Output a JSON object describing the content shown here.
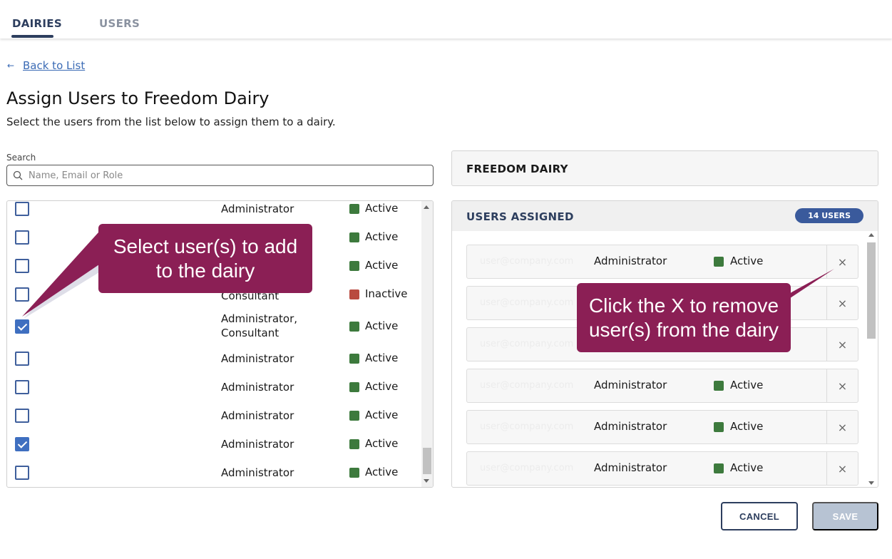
{
  "tabs": [
    {
      "label": "DAIRIES",
      "active": true
    },
    {
      "label": "USERS",
      "active": false
    }
  ],
  "back_link": {
    "arrow": "←",
    "label": "Back to List"
  },
  "page": {
    "title": "Assign Users to Freedom Dairy",
    "subtitle": "Select the users from the list below to assign them to a dairy."
  },
  "search": {
    "label": "Search",
    "placeholder": "Name, Email or Role",
    "value": ""
  },
  "available_users": [
    {
      "checked": false,
      "role": "Administrator",
      "role2": "",
      "status": "Active"
    },
    {
      "checked": false,
      "role": "",
      "role2": "",
      "status": "Active"
    },
    {
      "checked": false,
      "role": "",
      "role2": "",
      "status": "Active"
    },
    {
      "checked": false,
      "role": "Consultant",
      "role2": "",
      "status": "Inactive"
    },
    {
      "checked": true,
      "role": "Administrator,",
      "role2": "Consultant",
      "status": "Active"
    },
    {
      "checked": false,
      "role": "Administrator",
      "role2": "",
      "status": "Active"
    },
    {
      "checked": false,
      "role": "Administrator",
      "role2": "",
      "status": "Active"
    },
    {
      "checked": false,
      "role": "Administrator",
      "role2": "",
      "status": "Active"
    },
    {
      "checked": true,
      "role": "Administrator",
      "role2": "",
      "status": "Active"
    },
    {
      "checked": false,
      "role": "Administrator",
      "role2": "",
      "status": "Active"
    }
  ],
  "dairy": {
    "name": "FREEDOM DAIRY"
  },
  "assigned": {
    "title": "USERS ASSIGNED",
    "badge": "14 USERS",
    "remove_symbol": "×",
    "users": [
      {
        "email": "user@company.com",
        "role": "Administrator",
        "status": "Active"
      },
      {
        "email": "user@company.com",
        "role": "",
        "status": ""
      },
      {
        "email": "user@company.com",
        "role": "",
        "status": ""
      },
      {
        "email": "user@company.com",
        "role": "Administrator",
        "status": "Active"
      },
      {
        "email": "user@company.com",
        "role": "Administrator",
        "status": "Active"
      },
      {
        "email": "user@company.com",
        "role": "Administrator",
        "status": "Active"
      }
    ]
  },
  "callouts": {
    "select": {
      "line1": "Select user(s) to add",
      "line2": "to the dairy"
    },
    "remove": {
      "line1": "Click the X to remove",
      "line2": "user(s) from the dairy"
    }
  },
  "buttons": {
    "cancel": "CANCEL",
    "save": "SAVE"
  },
  "colors": {
    "active": "#3d7a3d",
    "inactive": "#b94a3f",
    "callout": "#8b1f55",
    "brand": "#2d3e5e"
  }
}
